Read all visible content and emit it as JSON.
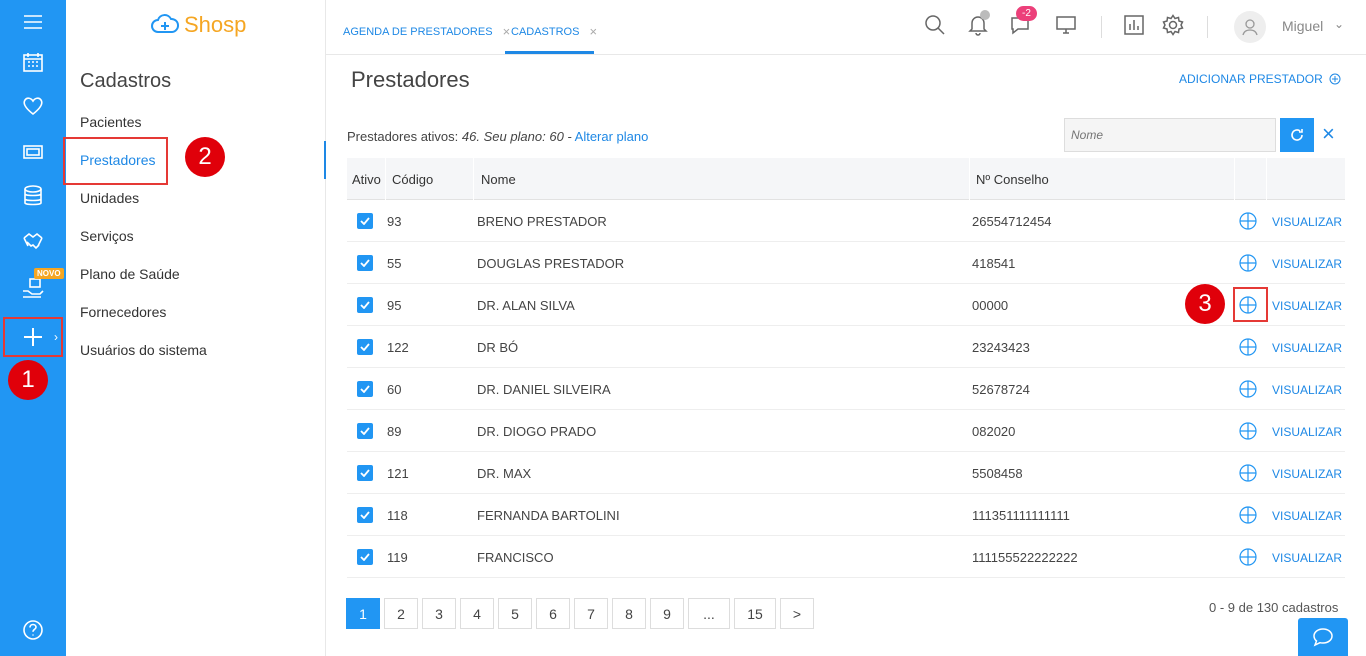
{
  "rail": {
    "novo_badge": "NOVO"
  },
  "markers": {
    "m1": "1",
    "m2": "2",
    "m3": "3"
  },
  "brand": {
    "name": "Shosp"
  },
  "sidebar": {
    "title": "Cadastros",
    "items": [
      {
        "label": "Pacientes"
      },
      {
        "label": "Prestadores"
      },
      {
        "label": "Unidades"
      },
      {
        "label": "Serviços"
      },
      {
        "label": "Plano de Saúde"
      },
      {
        "label": "Fornecedores"
      },
      {
        "label": "Usuários do sistema"
      }
    ],
    "active_index": 1
  },
  "tabs": [
    {
      "label": "AGENDA DE PRESTADORES"
    },
    {
      "label": "CADASTROS"
    }
  ],
  "topbar": {
    "chat_count": "-2",
    "user_name": "Miguel"
  },
  "main": {
    "title": "Prestadores",
    "add_label": "ADICIONAR PRESTADOR",
    "info_prefix": "Prestadores ativos: ",
    "info_highlight": "46. Seu plano: 60 -",
    "info_link": "Alterar plano",
    "search_placeholder": "Nome"
  },
  "table": {
    "headers": {
      "ativo": "Ativo",
      "codigo": "Código",
      "nome": "Nome",
      "conselho": "Nº Conselho"
    },
    "action_label": "VISUALIZAR",
    "rows": [
      {
        "code": "93",
        "name": "BRENO PRESTADOR",
        "conselho": "26554712454"
      },
      {
        "code": "55",
        "name": "DOUGLAS PRESTADOR",
        "conselho": "418541"
      },
      {
        "code": "95",
        "name": "DR. ALAN SILVA",
        "conselho": "00000"
      },
      {
        "code": "122",
        "name": "DR BÓ",
        "conselho": "23243423"
      },
      {
        "code": "60",
        "name": "DR. DANIEL SILVEIRA",
        "conselho": "52678724"
      },
      {
        "code": "89",
        "name": "DR. DIOGO PRADO",
        "conselho": "082020"
      },
      {
        "code": "121",
        "name": "DR. MAX",
        "conselho": "5508458"
      },
      {
        "code": "118",
        "name": "FERNANDA BARTOLINI",
        "conselho": "111351111111111"
      },
      {
        "code": "119",
        "name": "FRANCISCO",
        "conselho": "111155522222222"
      }
    ]
  },
  "pagination": {
    "pages": [
      "1",
      "2",
      "3",
      "4",
      "5",
      "6",
      "7",
      "8",
      "9",
      "...",
      "15",
      ">"
    ],
    "current": "1",
    "summary": "0 - 9 de 130 cadastros"
  },
  "colors": {
    "primary": "#2196f3",
    "highlight": "#e53935",
    "badge": "#ec407a",
    "novo": "#f5a623"
  }
}
